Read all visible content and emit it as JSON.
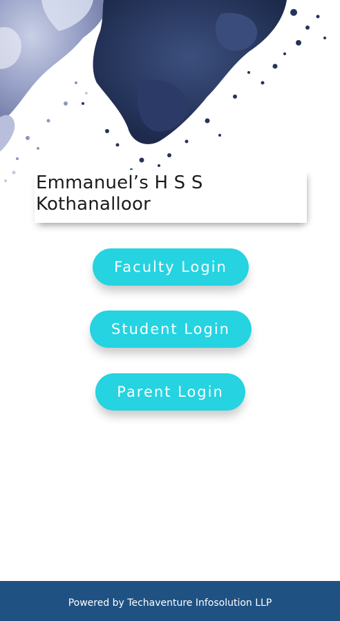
{
  "header": {
    "school_name": "Emmanuel’s H S S\nKothanalloor"
  },
  "logins": {
    "faculty_label": "Faculty Login",
    "student_label": "Student Login",
    "parent_label": "Parent Login"
  },
  "footer": {
    "text": "Powered by Techaventure Infosolution LLP",
    "bg_color": "#1f5283"
  },
  "colors": {
    "button": "#25d3e1",
    "button_text": "#ffffff"
  }
}
